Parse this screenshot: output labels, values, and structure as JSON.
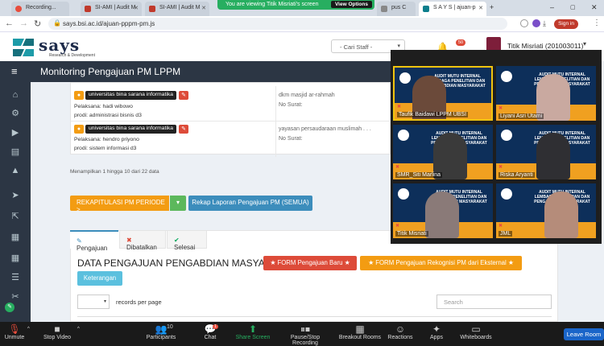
{
  "browser": {
    "tabs": [
      {
        "label": "Recording...",
        "color": "#e74c3c"
      },
      {
        "label": "SI-AMI | Audit M",
        "color": "#c0392b"
      },
      {
        "label": "SI-AMI | Audit M",
        "color": "#c0392b"
      },
      {
        "label": "pus C",
        "color": "#888888"
      },
      {
        "label": "S A Y S | ajuan-p",
        "color": "#0a7e8c"
      }
    ],
    "share_banner": "You are viewing Titik Misriati's screen",
    "view_options": "View Options",
    "url": "says.bsi.ac.id/ajuan-pppm-pm.js",
    "sign_in": "Sign in"
  },
  "header": {
    "logo": "says",
    "logo_sub": "Research & Development",
    "staff_placeholder": "- Cari Staff -",
    "notif_count": "50",
    "user_name": "Titik Misriati (201003011)"
  },
  "page": {
    "title": "Monitoring Pengajuan PM LPPM"
  },
  "rows": [
    {
      "tag": "universitas bina sarana informatika",
      "pelaksana": "Pelaksana: hadi wibowo",
      "prodi": "prodi: administrasi bisnis d3",
      "mitra": "dkm masjid ar-rahmah",
      "surat": "No Surat:"
    },
    {
      "tag": "universitas bina sarana informatika",
      "pelaksana": "Pelaksana: hendro priyono",
      "prodi": "prodi: sistem informasi d3",
      "mitra": "yayasan persaudaraan muslimah . . .",
      "surat": "No Surat:"
    }
  ],
  "showing": "Menampilkan 1 hingga 10 dari 22 data",
  "buttons": {
    "recap": "REKAPITULASI PM PERIODE >",
    "rekap_all": "Rekap Laporan Pengajuan PM (SEMUA)",
    "form_baru": "★ FORM Pengajuan Baru ★",
    "form_rekog": "★ FORM Pengajuan Rekognisi PM dari Eksternal ★",
    "keterangan": "Keterangan"
  },
  "tabs": {
    "pengajuan": "Pengajuan",
    "dibatalkan": "Dibatalkan",
    "selesai": "Selesai"
  },
  "data_title": "DATA PENGAJUAN PENGABDIAN MASYARAKAT",
  "per_page_label": "records per page",
  "search_placeholder": "Search",
  "gallery": {
    "banner": "AUDIT MUTU INTERNAL LEMBAGA PENELITIAN DAN PENGABDIAN MASYARAKAT",
    "participants": [
      {
        "name": "Taufik Baidawi LPPM UBSI",
        "skin": "#6b4a3a"
      },
      {
        "name": "Liyani Asri Utami",
        "skin": "#c9a9a0"
      },
      {
        "name": "SMR_Siti Marlina",
        "skin": "#3a3a3a"
      },
      {
        "name": "Riska Aryanti",
        "skin": "#2f2f33"
      },
      {
        "name": "Titik Misriati",
        "skin": "#8a7a78"
      },
      {
        "name": "JML",
        "skin": "#b58c7a"
      }
    ]
  },
  "zoom": {
    "unmute": "Unmute",
    "stop_video": "Stop Video",
    "participants": "Participants",
    "participants_count": "10",
    "chat": "Chat",
    "chat_badge": "1",
    "share_screen": "Share Screen",
    "pause_recording": "Pause/Stop Recording",
    "breakout": "Breakout Rooms",
    "reactions": "Reactions",
    "apps": "Apps",
    "whiteboards": "Whiteboards",
    "leave": "Leave Room"
  }
}
